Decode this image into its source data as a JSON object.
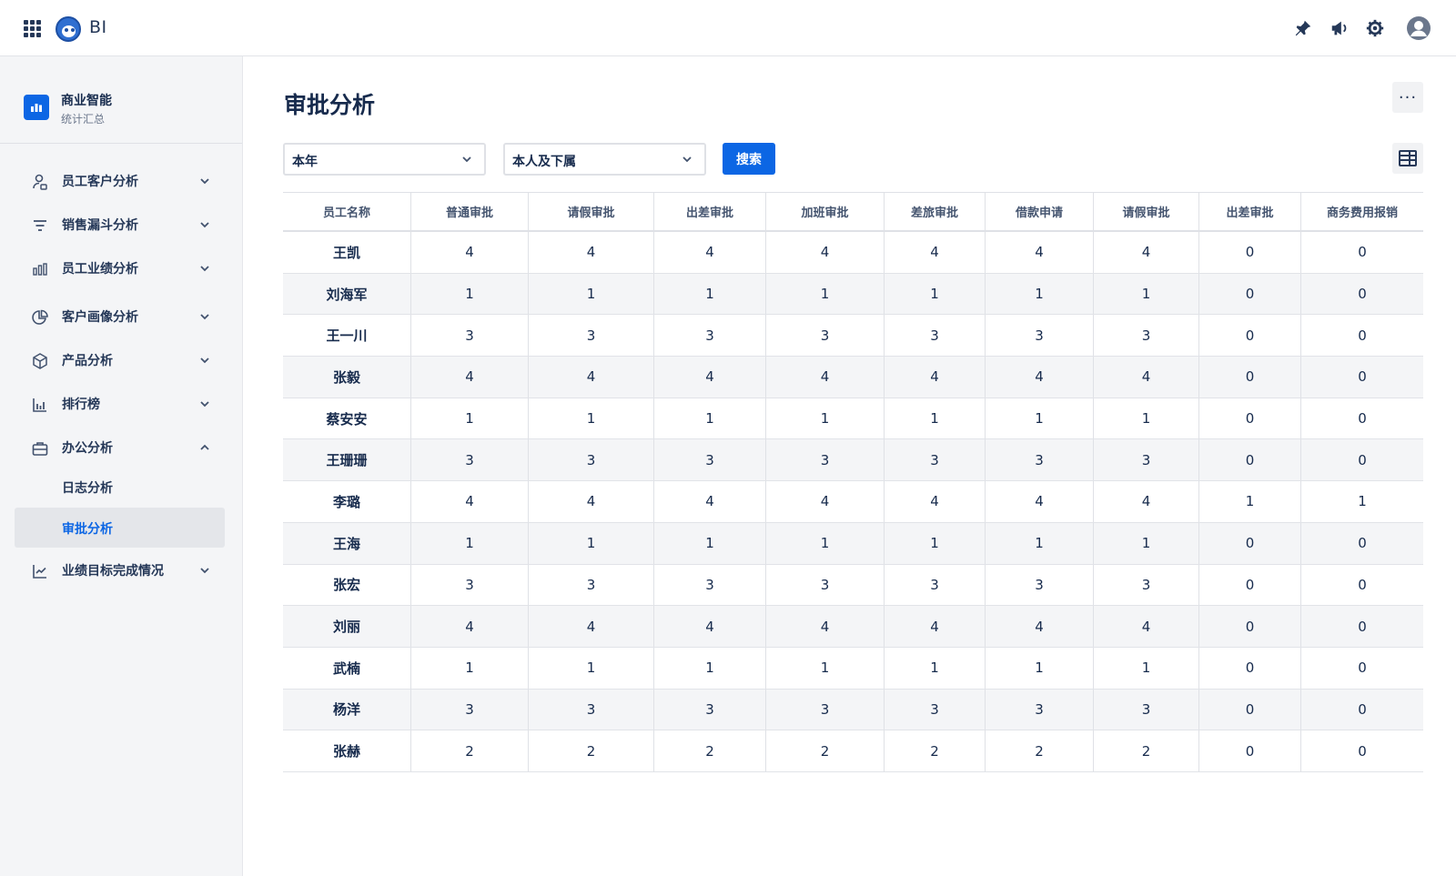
{
  "topbar": {
    "brand": "BI",
    "icons": [
      "apps-grid-icon",
      "app-logo",
      "pin-icon",
      "megaphone-icon",
      "gear-icon",
      "user-avatar-icon"
    ]
  },
  "sidebar": {
    "header": {
      "title": "商业智能",
      "subtitle": "统计汇总"
    },
    "items": [
      {
        "label": "员工客户分析",
        "icon": "user-search-icon",
        "expanded": false
      },
      {
        "label": "销售漏斗分析",
        "icon": "filter-icon",
        "expanded": false
      },
      {
        "label": "员工业绩分析",
        "icon": "bar-chart-icon",
        "expanded": false
      },
      {
        "label": "客户画像分析",
        "icon": "pie-chart-icon",
        "expanded": false
      },
      {
        "label": "产品分析",
        "icon": "cube-icon",
        "expanded": false
      },
      {
        "label": "排行榜",
        "icon": "ranking-chart-icon",
        "expanded": false
      },
      {
        "label": "办公分析",
        "icon": "briefcase-icon",
        "expanded": true
      },
      {
        "label": "业绩目标完成情况",
        "icon": "line-chart-icon",
        "expanded": false
      }
    ],
    "subitems": [
      {
        "label": "日志分析",
        "active": false
      },
      {
        "label": "审批分析",
        "active": true
      }
    ]
  },
  "main": {
    "title": "审批分析",
    "more_label": "···",
    "filters": {
      "period": "本年",
      "scope": "本人及下属",
      "search_label": "搜索"
    },
    "table": {
      "columns": [
        "员工名称",
        "普通审批",
        "请假审批",
        "出差审批",
        "加班审批",
        "差旅审批",
        "借款申请",
        "请假审批",
        "出差审批",
        "商务费用报销"
      ],
      "rows": [
        [
          "王凯",
          "4",
          "4",
          "4",
          "4",
          "4",
          "4",
          "4",
          "0",
          "0"
        ],
        [
          "刘海军",
          "1",
          "1",
          "1",
          "1",
          "1",
          "1",
          "1",
          "0",
          "0"
        ],
        [
          "王一川",
          "3",
          "3",
          "3",
          "3",
          "3",
          "3",
          "3",
          "0",
          "0"
        ],
        [
          "张毅",
          "4",
          "4",
          "4",
          "4",
          "4",
          "4",
          "4",
          "0",
          "0"
        ],
        [
          "蔡安安",
          "1",
          "1",
          "1",
          "1",
          "1",
          "1",
          "1",
          "0",
          "0"
        ],
        [
          "王珊珊",
          "3",
          "3",
          "3",
          "3",
          "3",
          "3",
          "3",
          "0",
          "0"
        ],
        [
          "李璐",
          "4",
          "4",
          "4",
          "4",
          "4",
          "4",
          "4",
          "1",
          "1"
        ],
        [
          "王海",
          "1",
          "1",
          "1",
          "1",
          "1",
          "1",
          "1",
          "0",
          "0"
        ],
        [
          "张宏",
          "3",
          "3",
          "3",
          "3",
          "3",
          "3",
          "3",
          "0",
          "0"
        ],
        [
          "刘丽",
          "4",
          "4",
          "4",
          "4",
          "4",
          "4",
          "4",
          "0",
          "0"
        ],
        [
          "武楠",
          "1",
          "1",
          "1",
          "1",
          "1",
          "1",
          "1",
          "0",
          "0"
        ],
        [
          "杨洋",
          "3",
          "3",
          "3",
          "3",
          "3",
          "3",
          "3",
          "0",
          "0"
        ],
        [
          "张赫",
          "2",
          "2",
          "2",
          "2",
          "2",
          "2",
          "2",
          "0",
          "0"
        ]
      ]
    }
  },
  "colors": {
    "accent": "#0c66e4",
    "sidebar_bg": "#f4f5f7",
    "text": "#172b4d"
  }
}
